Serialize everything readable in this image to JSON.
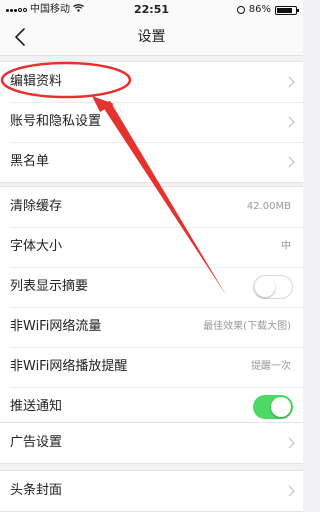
{
  "status_bar": {
    "carrier": "中国移动",
    "time": "22:51",
    "battery_percent": "86%",
    "battery_level": 0.86
  },
  "nav": {
    "title": "设置",
    "back_icon": "chevron-left-icon"
  },
  "groups": [
    {
      "rows": [
        {
          "label": "编辑资料"
        },
        {
          "label": "账号和隐私设置"
        },
        {
          "label": "黑名单"
        }
      ]
    },
    {
      "rows": [
        {
          "label": "清除缓存",
          "value": "42.00MB"
        },
        {
          "label": "字体大小",
          "value": "中"
        },
        {
          "label": "列表显示摘要",
          "toggle": false
        },
        {
          "label": "非WiFi网络流量",
          "value": "最佳效果(下载大图)"
        },
        {
          "label": "非WiFi网络播放提醒",
          "value": "提醒一次"
        },
        {
          "label": "推送通知",
          "toggle": true
        }
      ]
    },
    {
      "rows": [
        {
          "label": "广告设置"
        }
      ]
    },
    {
      "rows": [
        {
          "label": "头条封面"
        }
      ]
    }
  ],
  "colors": {
    "toggle_on": "#4cd964",
    "annotation_red": "#e5322d",
    "background": "#f2f2f4"
  }
}
